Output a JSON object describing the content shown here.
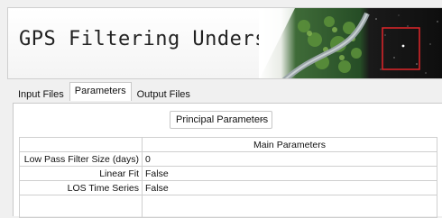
{
  "banner": {
    "title": "GPS Filtering Undersampling"
  },
  "tabs": [
    {
      "label": "Input Files"
    },
    {
      "label": "Parameters",
      "active": true
    },
    {
      "label": "Output Files"
    }
  ],
  "dropdown": {
    "selected": "Principal Parameters"
  },
  "table": {
    "header": "Main Parameters",
    "rows": [
      {
        "label": "Low Pass Filter Size (days)",
        "value": "0"
      },
      {
        "label": "Linear Fit",
        "value": "False"
      },
      {
        "label": "LOS Time Series",
        "value": "False"
      }
    ]
  }
}
